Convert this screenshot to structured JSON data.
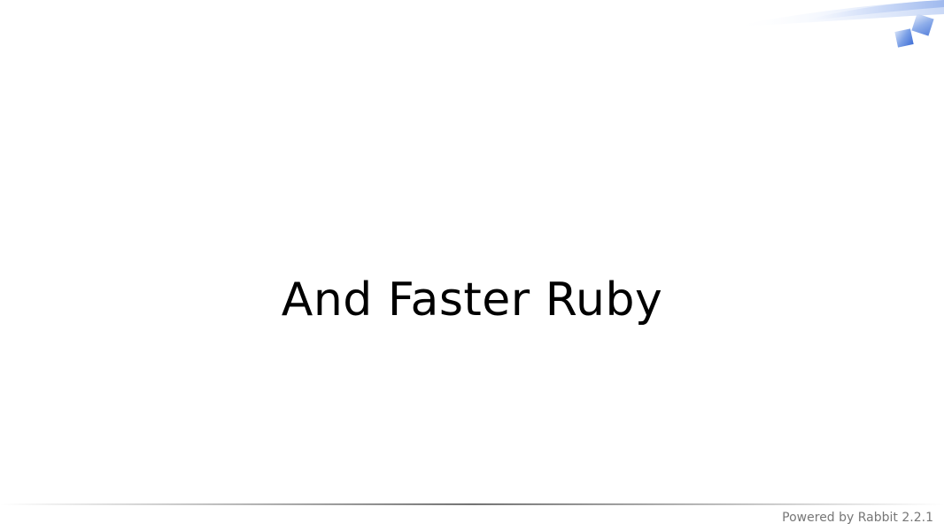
{
  "slide": {
    "title": "And Faster Ruby"
  },
  "footer": {
    "powered_by": "Powered by Rabbit 2.2.1"
  },
  "decoration": {
    "swoosh_color": "#9fb9ee",
    "square_color": "#5a86e0",
    "square_icon": "decorative-square-icon"
  },
  "colors": {
    "background": "#ffffff",
    "title": "#000000",
    "footer_text": "#777777",
    "footer_rule": "#444444"
  }
}
